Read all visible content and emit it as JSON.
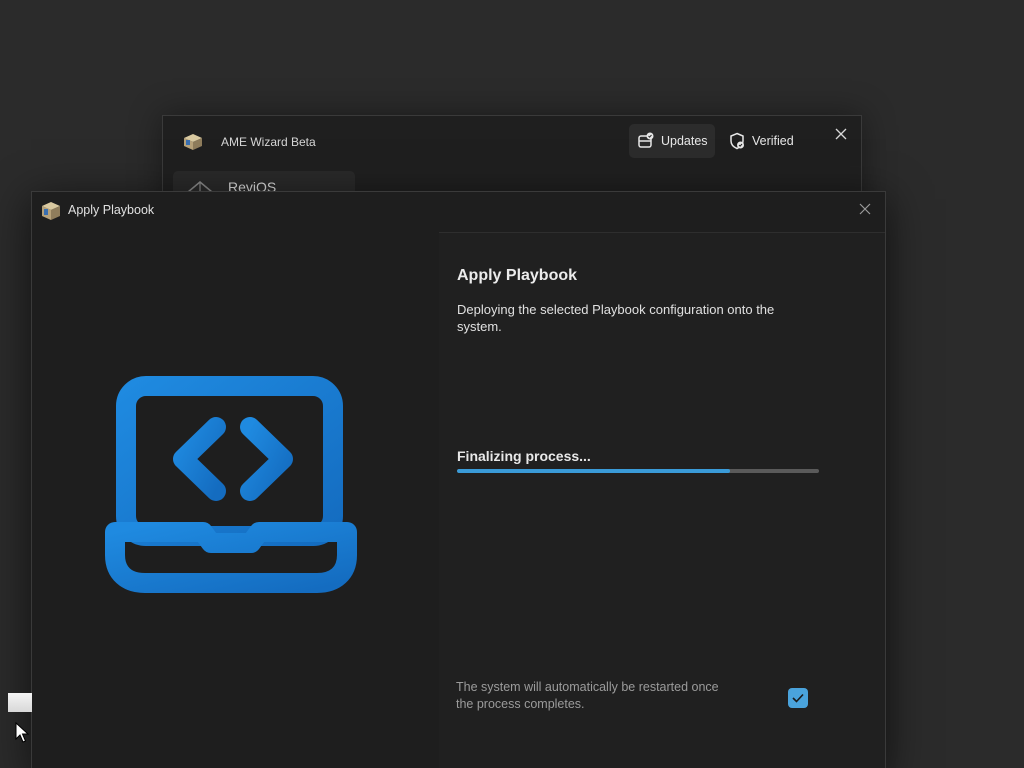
{
  "background_window": {
    "title": "AME Wizard Beta",
    "app_icon": "package-box-icon",
    "updates_label": "Updates",
    "updates_icon": "updates-icon",
    "verified_label": "Verified",
    "verified_icon": "shield-check-icon",
    "close_icon": "close-icon",
    "sidebar_item_label": "ReviOS",
    "sidebar_item_icon": "revios-logo-icon"
  },
  "dialog": {
    "title": "Apply Playbook",
    "app_icon": "package-box-icon",
    "close_icon": "close-icon",
    "illustration_icon": "laptop-code-icon",
    "heading": "Apply Playbook",
    "description": "Deploying the selected Playbook configuration onto the system.",
    "status_text": "Finalizing process...",
    "progress_fraction": 0.755,
    "restart_note": "The system will automatically be restarted once the process completes.",
    "restart_checked": true,
    "checkbox_icon": "checkmark-icon"
  },
  "colors": {
    "accent": "#3a9bd8",
    "checkbox": "#4aa3dc",
    "illustration_blue": "#1a7fd0",
    "window_bg": "#202020",
    "desktop_bg": "#2b2b2b"
  }
}
